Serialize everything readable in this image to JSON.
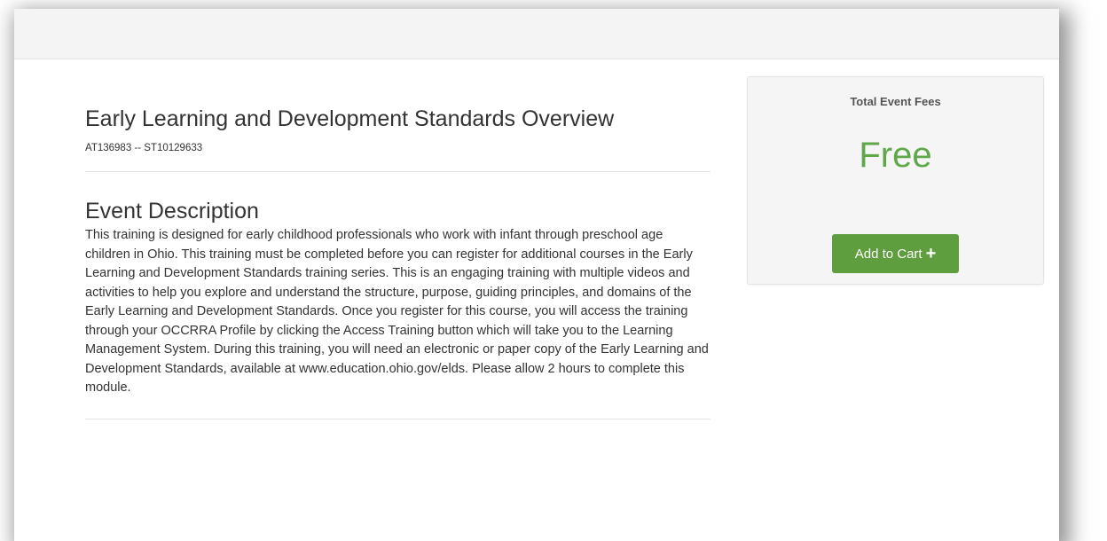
{
  "event": {
    "title": "Early Learning and Development Standards Overview",
    "codes": "AT136983 -- ST10129633"
  },
  "description": {
    "heading": "Event Description",
    "text": "This training is designed for early childhood professionals who work with infant through preschool age children in Ohio. This training must be completed before you can register for additional courses in the Early Learning and Development Standards training series. This is an engaging training with multiple videos and activities to help you explore and understand the structure, purpose, guiding principles, and domains of the Early Learning and Development Standards. Once you register for this course, you will access the training through your OCCRRA Profile by clicking the Access Training button which will take you to the Learning Management System. During this training, you will need an electronic or paper copy of the Early Learning and Development Standards, available at www.education.ohio.gov/elds. Please allow 2 hours to complete this module."
  },
  "fees": {
    "label": "Total Event Fees",
    "amount": "Free",
    "add_to_cart_label": "Add to Cart",
    "add_icon": "plus-icon"
  },
  "colors": {
    "accent_green": "#5e9e3f",
    "price_green": "#5fa84a"
  }
}
